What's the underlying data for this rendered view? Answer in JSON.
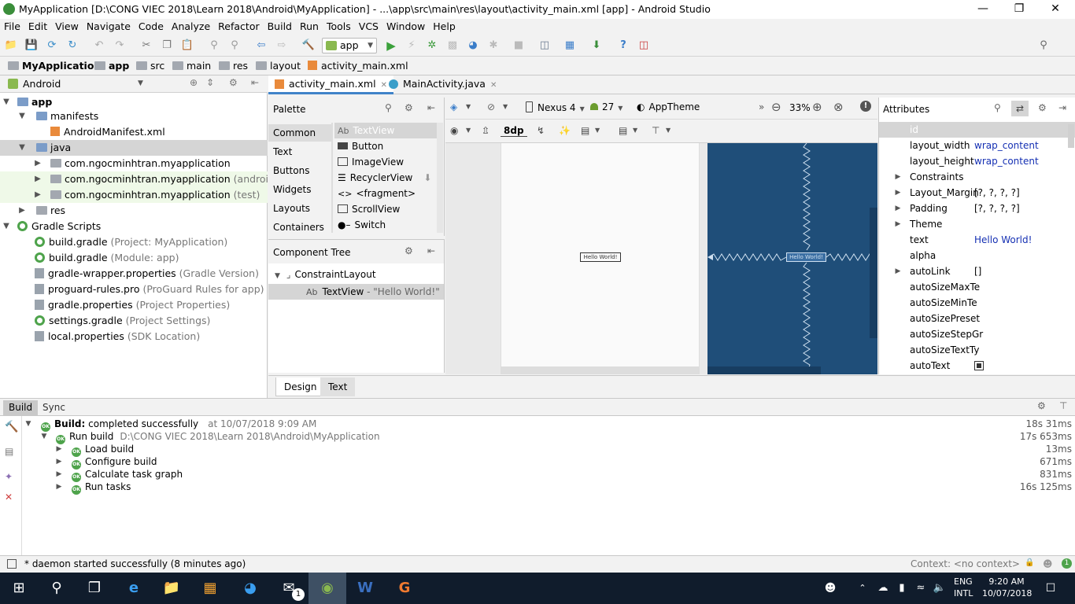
{
  "window": {
    "title": "MyApplication [D:\\CONG VIEC 2018\\Learn 2018\\Android\\MyApplication] - ...\\app\\src\\main\\res\\layout\\activity_main.xml [app] - Android Studio"
  },
  "menu": [
    "File",
    "Edit",
    "View",
    "Navigate",
    "Code",
    "Analyze",
    "Refactor",
    "Build",
    "Run",
    "Tools",
    "VCS",
    "Window",
    "Help"
  ],
  "toolbar": {
    "run_config": "app"
  },
  "breadcrumb": [
    "MyApplication",
    "app",
    "src",
    "main",
    "res",
    "layout",
    "activity_main.xml"
  ],
  "project": {
    "view_mode": "Android",
    "items": [
      {
        "label": "app",
        "extra": ""
      },
      {
        "label": "manifests",
        "extra": ""
      },
      {
        "label": "AndroidManifest.xml",
        "extra": ""
      },
      {
        "label": "java",
        "extra": ""
      },
      {
        "label": "com.ngocminhtran.myapplication",
        "extra": ""
      },
      {
        "label": "com.ngocminhtran.myapplication",
        "extra": "(androidTest)"
      },
      {
        "label": "com.ngocminhtran.myapplication",
        "extra": "(test)"
      },
      {
        "label": "res",
        "extra": ""
      },
      {
        "label": "Gradle Scripts",
        "extra": ""
      },
      {
        "label": "build.gradle",
        "extra": "(Project: MyApplication)"
      },
      {
        "label": "build.gradle",
        "extra": "(Module: app)"
      },
      {
        "label": "gradle-wrapper.properties",
        "extra": "(Gradle Version)"
      },
      {
        "label": "proguard-rules.pro",
        "extra": "(ProGuard Rules for app)"
      },
      {
        "label": "gradle.properties",
        "extra": "(Project Properties)"
      },
      {
        "label": "settings.gradle",
        "extra": "(Project Settings)"
      },
      {
        "label": "local.properties",
        "extra": "(SDK Location)"
      }
    ]
  },
  "editor_tabs": [
    "activity_main.xml",
    "MainActivity.java"
  ],
  "palette": {
    "title": "Palette",
    "categories": [
      "Common",
      "Text",
      "Buttons",
      "Widgets",
      "Layouts",
      "Containers"
    ],
    "widget_items": [
      "TextView",
      "Button",
      "ImageView",
      "RecyclerView",
      "<fragment>",
      "ScrollView",
      "Switch"
    ],
    "textview_prefix": "Ab"
  },
  "component_tree": {
    "title": "Component Tree",
    "root": "ConstraintLayout",
    "child_prefix": "Ab",
    "child": "TextView",
    "child_extra": "- \"Hello World!\""
  },
  "design": {
    "device": "Nexus 4",
    "api": "27",
    "theme": "AppTheme",
    "zoom": "33%",
    "margin": "8dp",
    "preview_text": "Hello World!"
  },
  "attributes": {
    "title": "Attributes",
    "rows": [
      {
        "name": "id",
        "value": ""
      },
      {
        "name": "layout_width",
        "value": "wrap_content"
      },
      {
        "name": "layout_height",
        "value": "wrap_content"
      },
      {
        "name": "Constraints",
        "value": ""
      },
      {
        "name": "Layout_Margin",
        "value": "[?, ?, ?, ?]"
      },
      {
        "name": "Padding",
        "value": "[?, ?, ?, ?]"
      },
      {
        "name": "Theme",
        "value": ""
      },
      {
        "name": "text",
        "value": "Hello World!"
      },
      {
        "name": "alpha",
        "value": ""
      },
      {
        "name": "autoLink",
        "value": "[]"
      },
      {
        "name": "autoSizeMaxTe",
        "value": ""
      },
      {
        "name": "autoSizeMinTe",
        "value": ""
      },
      {
        "name": "autoSizePreset",
        "value": ""
      },
      {
        "name": "autoSizeStepGr",
        "value": ""
      },
      {
        "name": "autoSizeTextTy",
        "value": ""
      },
      {
        "name": "autoText",
        "value": ""
      }
    ]
  },
  "bottom_tabs": {
    "design": "Design",
    "text": "Text"
  },
  "build": {
    "tabs": [
      "Build",
      "Sync"
    ],
    "header_label": "Build:",
    "header_status": "completed successfully",
    "header_time": "at 10/07/2018 9:09 AM",
    "header_duration": "18s 31ms",
    "run_label": "Run build",
    "run_path": "D:\\CONG VIEC 2018\\Learn 2018\\Android\\MyApplication",
    "run_duration": "17s 653ms",
    "ok_badge": "OK",
    "tasks": [
      {
        "name": "Load build",
        "time": "13ms"
      },
      {
        "name": "Configure build",
        "time": "671ms"
      },
      {
        "name": "Calculate task graph",
        "time": "831ms"
      },
      {
        "name": "Run tasks",
        "time": "16s 125ms"
      }
    ]
  },
  "status": {
    "message": "* daemon started successfully (8 minutes ago)",
    "context": "Context: <no context>"
  },
  "taskbar": {
    "lang1": "ENG",
    "lang2": "INTL",
    "time": "9:20 AM",
    "date": "10/07/2018",
    "badge": "1"
  }
}
